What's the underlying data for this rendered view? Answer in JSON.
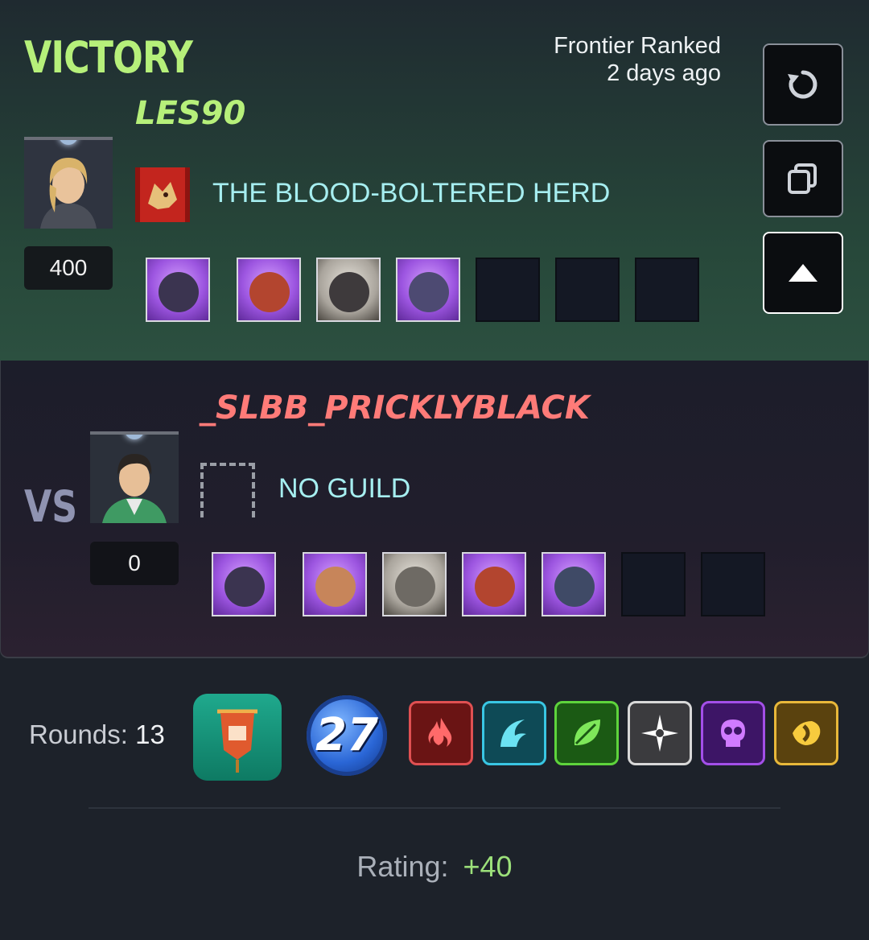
{
  "result": "VICTORY",
  "match": {
    "mode": "Frontier Ranked",
    "time": "2 days ago"
  },
  "winner": {
    "name": "LES90",
    "rating": "400",
    "guild": "THE BLOOD-BOLTERED HERD",
    "cards": [
      "purple-card",
      "purple-card",
      "gray-card",
      "purple-card",
      "empty-slot",
      "empty-slot",
      "empty-slot"
    ]
  },
  "vs_label": "VS",
  "loser": {
    "name": "_SLBB_PRICKLYBLACK",
    "rating": "0",
    "guild": "NO GUILD",
    "cards": [
      "purple-card",
      "purple-card",
      "gray-card",
      "purple-card",
      "purple-card",
      "empty-slot",
      "empty-slot"
    ]
  },
  "buttons": {
    "replay_icon": "replay-icon",
    "copy_icon": "copy-icon",
    "collapse_icon": "chevron-up-icon"
  },
  "summary": {
    "rounds_label": "Rounds:",
    "rounds_value": "13",
    "ruleset_icon": "banner-ruleset-icon",
    "mana_cap": "27",
    "elements": [
      {
        "name": "fire",
        "color": "#e05052"
      },
      {
        "name": "water",
        "color": "#39c6e3"
      },
      {
        "name": "earth",
        "color": "#5ed43c"
      },
      {
        "name": "life",
        "color": "#d8d8d8"
      },
      {
        "name": "death",
        "color": "#a34fe8"
      },
      {
        "name": "dragon",
        "color": "#e8b83a"
      }
    ],
    "rating_label": "Rating:",
    "rating_delta": "+40"
  }
}
